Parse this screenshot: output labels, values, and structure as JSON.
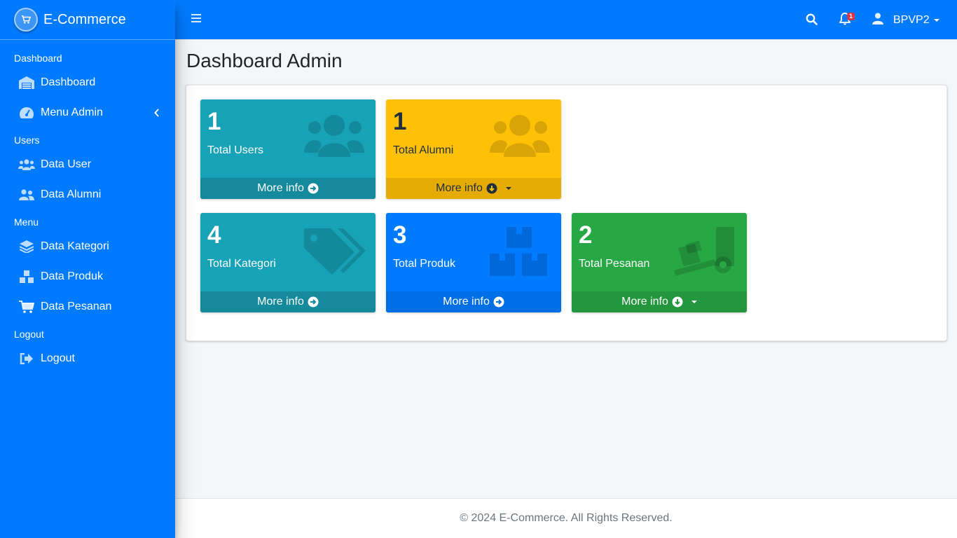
{
  "brand": {
    "name": "E-Commerce",
    "icon": "cart-icon"
  },
  "sidebar": {
    "sections": [
      {
        "header": "Dashboard",
        "items": [
          {
            "label": "Dashboard",
            "icon": "warehouse-icon"
          },
          {
            "label": "Menu Admin",
            "icon": "gauge-icon",
            "expandable": true
          }
        ]
      },
      {
        "header": "Users",
        "items": [
          {
            "label": "Data User",
            "icon": "users-icon"
          },
          {
            "label": "Data Alumni",
            "icon": "user-friends-icon"
          }
        ]
      },
      {
        "header": "Menu",
        "items": [
          {
            "label": "Data Kategori",
            "icon": "layers-icon"
          },
          {
            "label": "Data Produk",
            "icon": "boxes-icon"
          },
          {
            "label": "Data Pesanan",
            "icon": "cart-icon"
          }
        ]
      },
      {
        "header": "Logout",
        "items": [
          {
            "label": "Logout",
            "icon": "sign-out-icon"
          }
        ]
      }
    ]
  },
  "topbar": {
    "notification_count": "1",
    "username": "BPVP2"
  },
  "page": {
    "title": "Dashboard Admin"
  },
  "stats": [
    {
      "value": "1",
      "label": "Total Users",
      "more": "More info",
      "color": "#17a2b8",
      "icon": "users-icon",
      "arrow": "arrow-circle-right-icon"
    },
    {
      "value": "1",
      "label": "Total Alumni",
      "more": "More info",
      "color": "#ffc107",
      "icon": "users-icon",
      "arrow": "arrow-circle-down-icon",
      "dropdown": true
    },
    {
      "value": "4",
      "label": "Total Kategori",
      "more": "More info",
      "color": "#17a2b8",
      "icon": "tags-icon",
      "arrow": "arrow-circle-right-icon"
    },
    {
      "value": "3",
      "label": "Total Produk",
      "more": "More info",
      "color": "#007bff",
      "icon": "boxes-icon",
      "arrow": "arrow-circle-right-icon"
    },
    {
      "value": "2",
      "label": "Total Pesanan",
      "more": "More info",
      "color": "#28a745",
      "icon": "dolly-icon",
      "arrow": "arrow-circle-down-icon",
      "dropdown": true
    }
  ],
  "footer": {
    "text": "© 2024 E-Commerce. All Rights Reserved."
  },
  "colors": {
    "primary": "#007bff",
    "info": "#17a2b8",
    "warning": "#ffc107",
    "success": "#28a745",
    "danger": "#dc3545"
  }
}
